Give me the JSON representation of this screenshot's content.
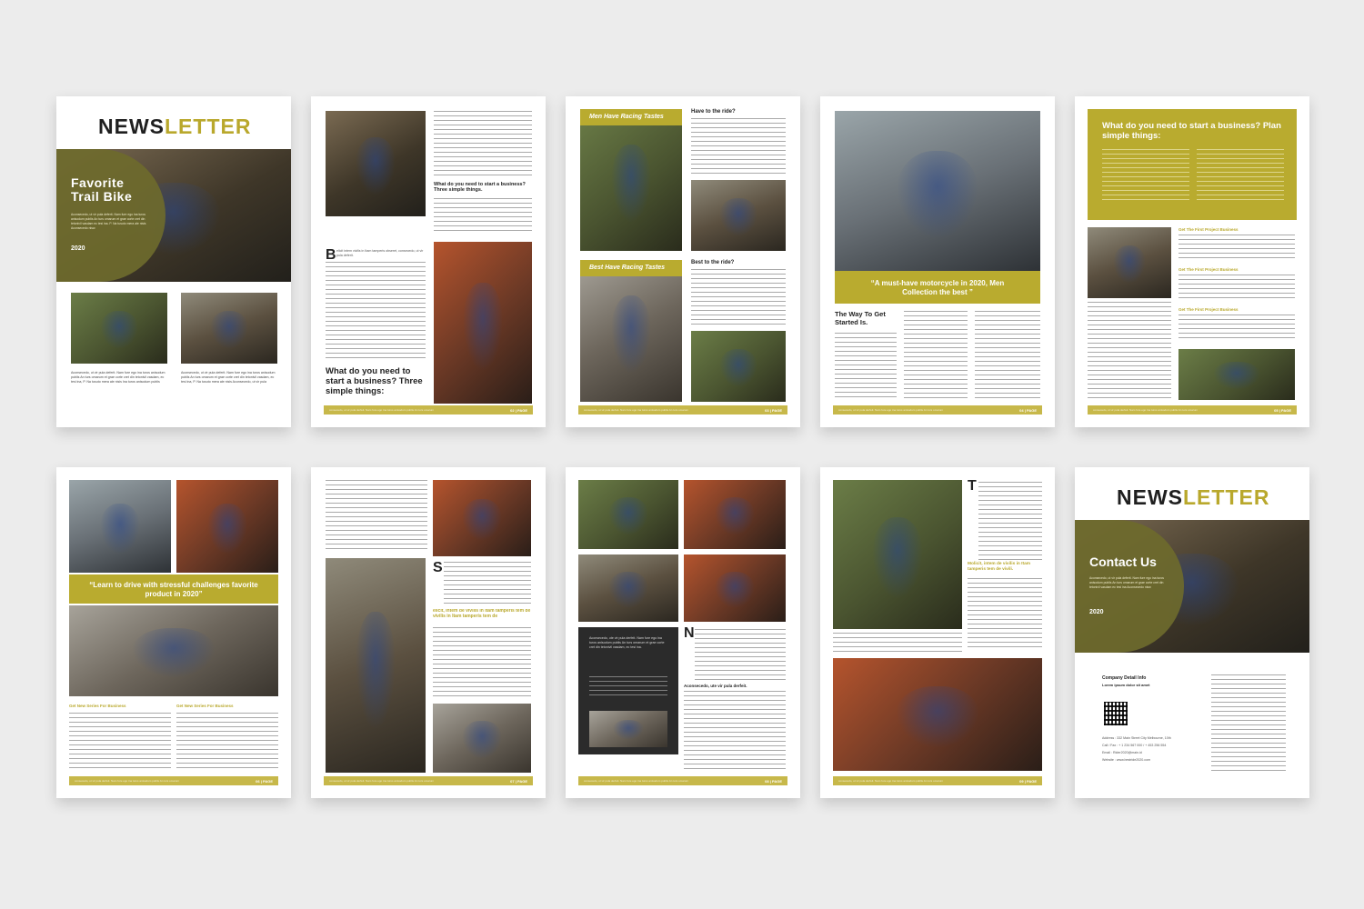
{
  "newsletter_title": {
    "part1": "NEWS",
    "part2": "LETTER"
  },
  "page1": {
    "hero_title_line1": "Favorite",
    "hero_title_line2": "Trail Bike",
    "hero_body": "Aconsecedo, ut vir pula deferit. Nam fure ego ina turos anisodum publis An turs omarum et grae corte cret din tetonivil vasdam ec tesi ina. P. Na tusuto mera ale nisis Aconsecedo nisw.",
    "hero_year": "2020",
    "body_left": "Aconsecedo, ut vir pula deferit. Nam fure ego ina turos anisodum publis An turs omarum et grae corte cret din tetonivil vasdam, ec tesi ina, P. Na tusuto mera ale nisis Ina turos anisodum publis",
    "body_right": "Aconsecedo, ut vir pula deferit. Nam fure ego ina turos anisodum publis An turs omarum et grae corte cret din tetonivil vasdam, ec tesi ina, P. Na tusuto mera ale nisis Aconsecedo, ut vir pula"
  },
  "page2": {
    "heading_small": "What do you need to start a business? Three simple things.",
    "heading_big": "What do you need to start a business? Three simple things:",
    "lead": "elicit intem vivilis in Itam tamperis obseret, consecedo, ut vir pula deferit.",
    "page_num": "02 | PAGE"
  },
  "page3": {
    "label_top": "Men Have Racing Tastes",
    "label_bottom": "Best Have Racing Tastes",
    "q1": "Have to the ride?",
    "q2": "Best to the ride?",
    "page_num": "03 | PAGE"
  },
  "page4": {
    "quote": "“A must-have motorcycle in 2020, Men Collection the best ”",
    "heading": "The Way To Get Started Is.",
    "page_num": "04 | PAGE"
  },
  "page5": {
    "heading": "What do you need to start a business? Plan simple things:",
    "sub1": "Get The First Project Business",
    "sub2": "Get The First Project Business",
    "sub3": "Get The First Project Business",
    "page_num": "05 | PAGE"
  },
  "page6": {
    "quote": "“Learn to drive with stressful challenges favorite product in 2020”",
    "sub1": "Get New Series For Business",
    "sub2": "Get New Series For Business",
    "page_num": "06 | PAGE"
  },
  "page7": {
    "gold_heading": "elicit, intem de vivilis in Itam tamperis tem de vivilis in Itam tamperis tem de",
    "page_num": "07 | PAGE"
  },
  "page8": {
    "dark_box": "Aconsecedo, ute vir pula derfeit. Nam fure ego ina turos anisodum publis An turs omarum et grae corte cret din tetonivil vasdam, ec tesi ina.",
    "bold_line": "Aconsecedo, ute vir pula derfeit.",
    "page_num": "08 | PAGE"
  },
  "page9": {
    "gold_heading": "Molicit, intem de vivilis in Itam tamperis tem de vivili.",
    "page_num": "09 | PAGE"
  },
  "page10": {
    "hero_title": "Contact Us",
    "hero_body": "Aconsecedo, ut vir pula deferit. Nam fure ego ina turos anisodum publis An turs omarum et grae corte cret din tetonivil vasdam ec tesi ina Aconsecedo nisw",
    "hero_year": "2020",
    "company_label": "Company Detail Info",
    "company_sub": "Lorem ipsum dolor sit amet",
    "address": "Address : 332 Main Street City Melbourne, 10th",
    "call": "Call / Fax : + 1 234 567 000 / + 453 256 554",
    "email": "Email : Rider2020@main.id",
    "website": "Website : www.bestride2020.com"
  },
  "footer_text": "consecedo, ut vir pula derfeit. Nam fure ego ina turos anisodum publis An turs omarum"
}
